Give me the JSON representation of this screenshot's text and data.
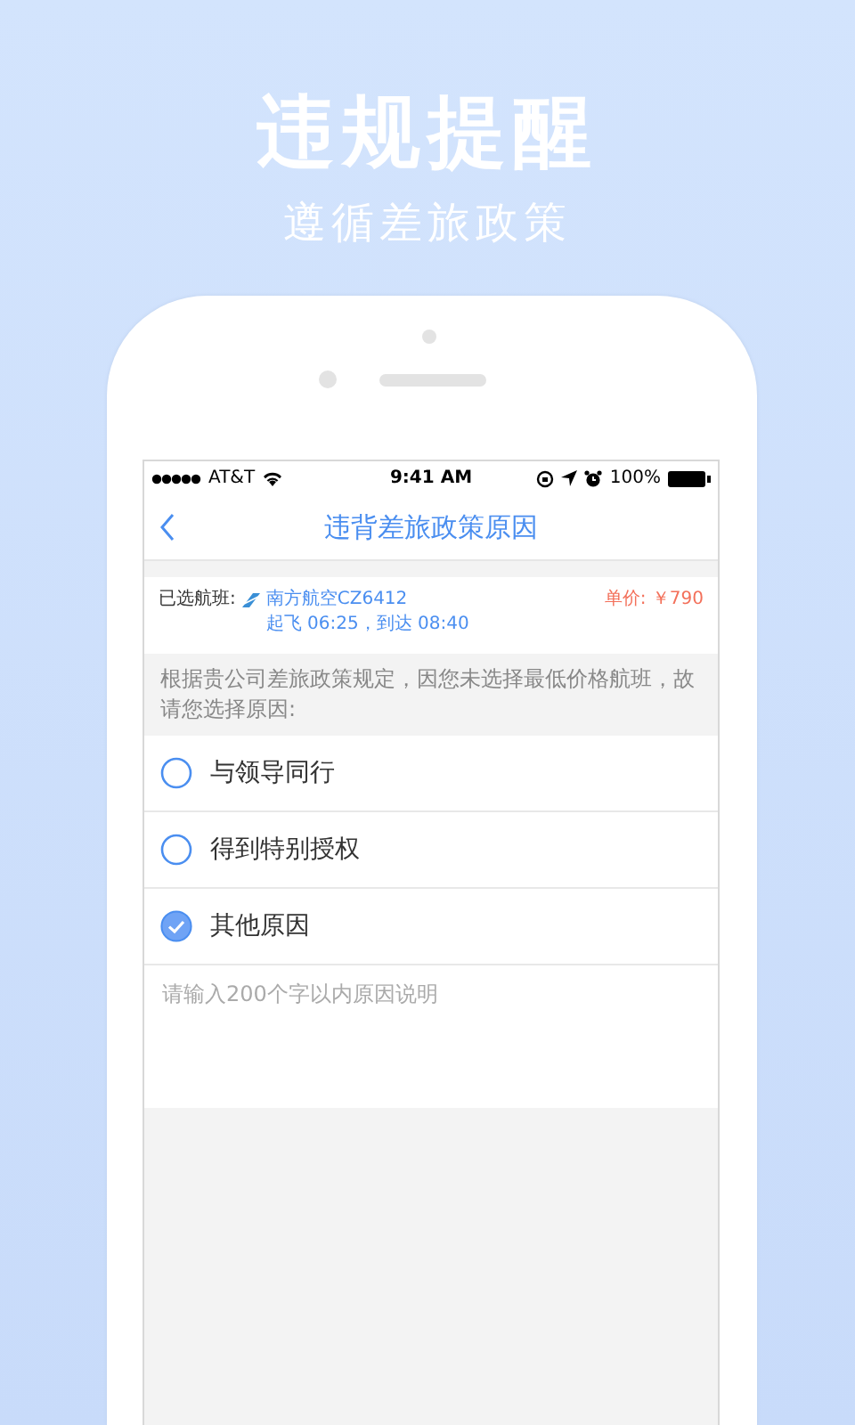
{
  "headline": "违规提醒",
  "subheadline": "遵循差旅政策",
  "status_bar": {
    "carrier": "AT&T",
    "time": "9:41 AM",
    "battery": "100%"
  },
  "nav": {
    "title": "违背差旅政策原因"
  },
  "flight": {
    "label": "已选航班:",
    "airline": "南方航空CZ6412",
    "times": "起飞 06:25，到达 08:40",
    "price": "单价: ￥790"
  },
  "notice": "根据贵公司差旅政策规定，因您未选择最低价格航班，故请您选择原因:",
  "reasons": [
    {
      "label": "与领导同行",
      "selected": false
    },
    {
      "label": "得到特别授权",
      "selected": false
    },
    {
      "label": "其他原因",
      "selected": true
    }
  ],
  "explanation": {
    "placeholder": "请输入200个字以内原因说明"
  }
}
